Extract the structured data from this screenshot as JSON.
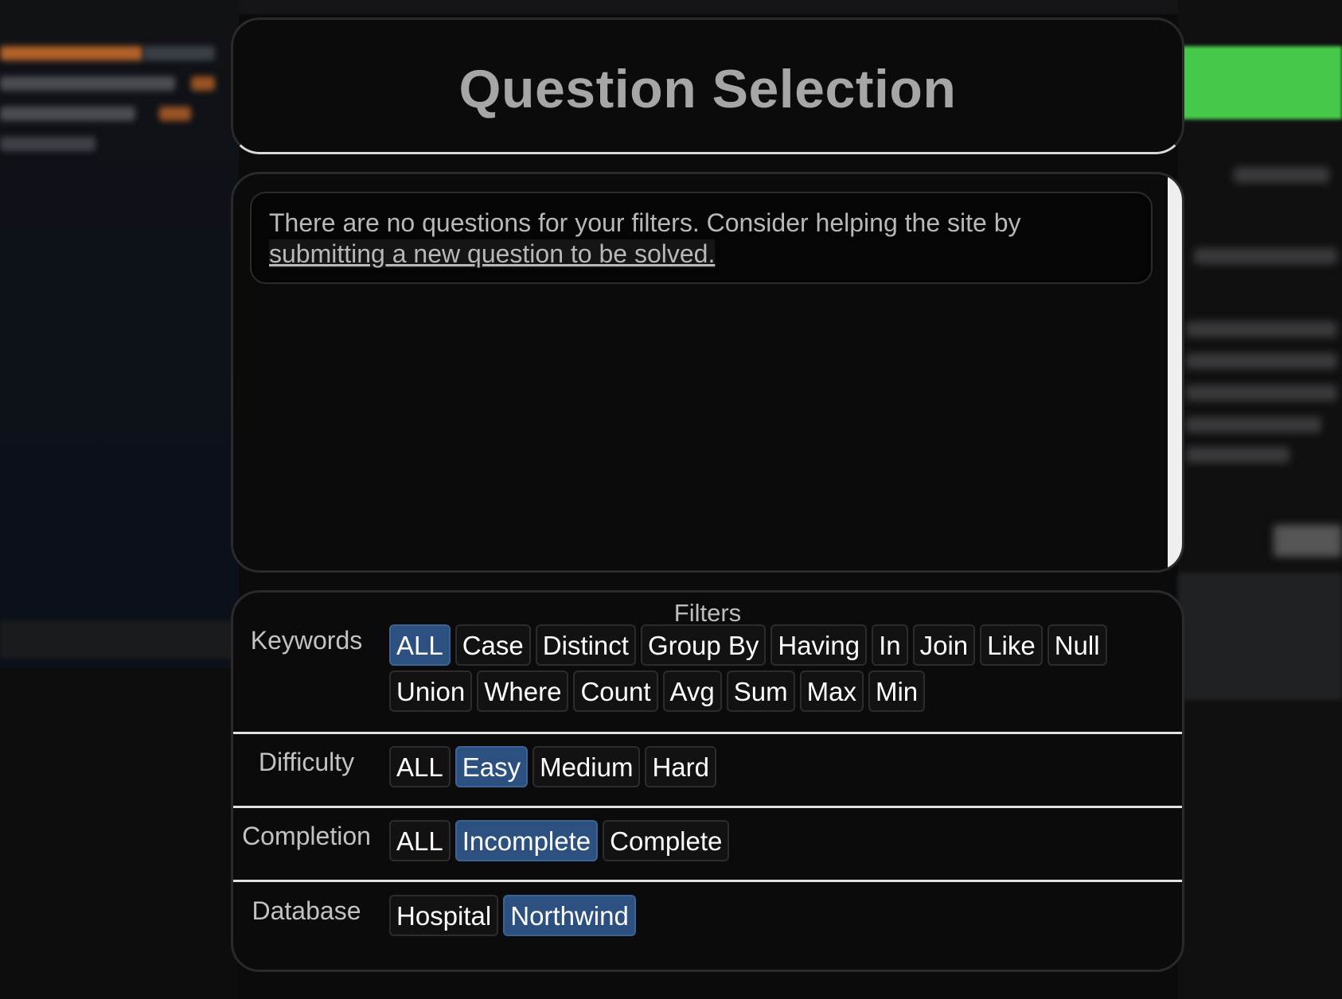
{
  "page": {
    "title": "Question Selection"
  },
  "questions": {
    "empty_message": "There are no questions for your filters. Consider helping the site by",
    "submit_link": "submitting a new question to be solved."
  },
  "filters": {
    "heading": "Filters",
    "keywords": {
      "label": "Keywords",
      "options": [
        {
          "label": "ALL",
          "active": true
        },
        {
          "label": "Case",
          "active": false
        },
        {
          "label": "Distinct",
          "active": false
        },
        {
          "label": "Group By",
          "active": false
        },
        {
          "label": "Having",
          "active": false
        },
        {
          "label": "In",
          "active": false
        },
        {
          "label": "Join",
          "active": false
        },
        {
          "label": "Like",
          "active": false
        },
        {
          "label": "Null",
          "active": false
        },
        {
          "label": "Union",
          "active": false
        },
        {
          "label": "Where",
          "active": false
        },
        {
          "label": "Count",
          "active": false
        },
        {
          "label": "Avg",
          "active": false
        },
        {
          "label": "Sum",
          "active": false
        },
        {
          "label": "Max",
          "active": false
        },
        {
          "label": "Min",
          "active": false
        }
      ]
    },
    "difficulty": {
      "label": "Difficulty",
      "options": [
        {
          "label": "ALL",
          "active": false
        },
        {
          "label": "Easy",
          "active": true
        },
        {
          "label": "Medium",
          "active": false
        },
        {
          "label": "Hard",
          "active": false
        }
      ]
    },
    "completion": {
      "label": "Completion",
      "options": [
        {
          "label": "ALL",
          "active": false
        },
        {
          "label": "Incomplete",
          "active": true
        },
        {
          "label": "Complete",
          "active": false
        }
      ]
    },
    "database": {
      "label": "Database",
      "options": [
        {
          "label": "Hospital",
          "active": false
        },
        {
          "label": "Northwind",
          "active": true
        }
      ]
    }
  },
  "colors": {
    "active_chip": "#2c5080",
    "background": "#0b0b0b",
    "title_text": "#a6a6a6"
  }
}
